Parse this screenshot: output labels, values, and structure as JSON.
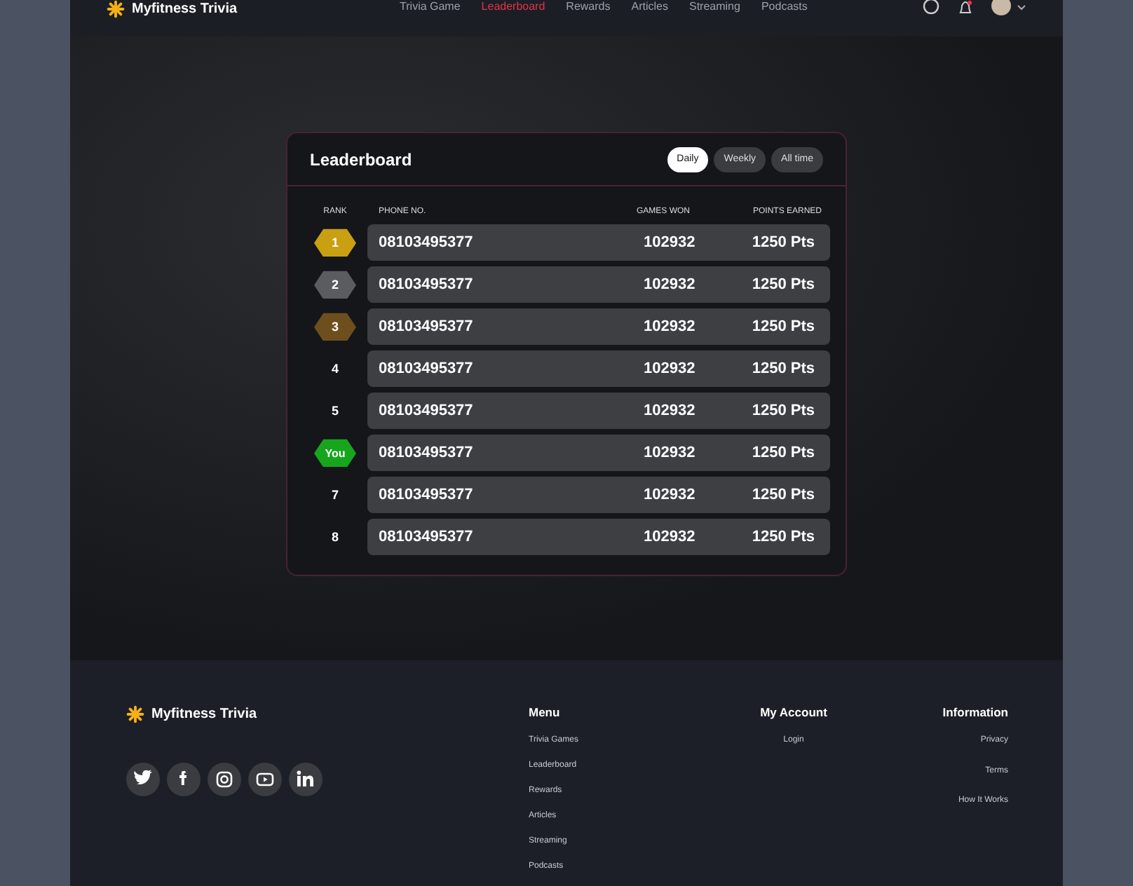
{
  "header": {
    "brand": "Myfitness Trivia",
    "nav": [
      {
        "label": "Trivia Game",
        "selected": false
      },
      {
        "label": "Leaderboard",
        "selected": true
      },
      {
        "label": "Rewards",
        "selected": false
      },
      {
        "label": "Articles",
        "selected": false
      },
      {
        "label": "Streaming",
        "selected": false
      },
      {
        "label": "Podcasts",
        "selected": false
      }
    ]
  },
  "leaderboard": {
    "title": "Leaderboard",
    "filters": [
      {
        "label": "Daily",
        "selected": true
      },
      {
        "label": "Weekly",
        "selected": false
      },
      {
        "label": "All time",
        "selected": false
      }
    ],
    "columns": [
      "RANK",
      "PHONE NO.",
      "GAMES WON",
      "POINTS EARNED"
    ],
    "rows": [
      {
        "kind": "gold",
        "rank": "1",
        "phone": "08103495377",
        "games_won": "102932",
        "points": "1250 Pts"
      },
      {
        "kind": "silver",
        "rank": "2",
        "phone": "08103495377",
        "games_won": "102932",
        "points": "1250 Pts"
      },
      {
        "kind": "bronze",
        "rank": "3",
        "phone": "08103495377",
        "games_won": "102932",
        "points": "1250 Pts"
      },
      {
        "kind": "plain",
        "rank": "4",
        "phone": "08103495377",
        "games_won": "102932",
        "points": "1250 Pts"
      },
      {
        "kind": "plain",
        "rank": "5",
        "phone": "08103495377",
        "games_won": "102932",
        "points": "1250 Pts"
      },
      {
        "kind": "you",
        "rank": "You",
        "phone": "08103495377",
        "games_won": "102932",
        "points": "1250 Pts"
      },
      {
        "kind": "plain",
        "rank": "7",
        "phone": "08103495377",
        "games_won": "102932",
        "points": "1250 Pts"
      },
      {
        "kind": "plain",
        "rank": "8",
        "phone": "08103495377",
        "games_won": "102932",
        "points": "1250 Pts"
      }
    ]
  },
  "footer": {
    "brand": "Myfitness Trivia",
    "columns": [
      {
        "title": "Menu",
        "links": [
          "Trivia Games",
          "Leaderboard",
          "Rewards",
          "Articles",
          "Streaming",
          "Podcasts"
        ]
      },
      {
        "title": "My Account",
        "links": [
          "Login"
        ]
      },
      {
        "title": "Information",
        "links": [
          "Privacy",
          "Terms",
          "How It Works"
        ]
      }
    ]
  }
}
